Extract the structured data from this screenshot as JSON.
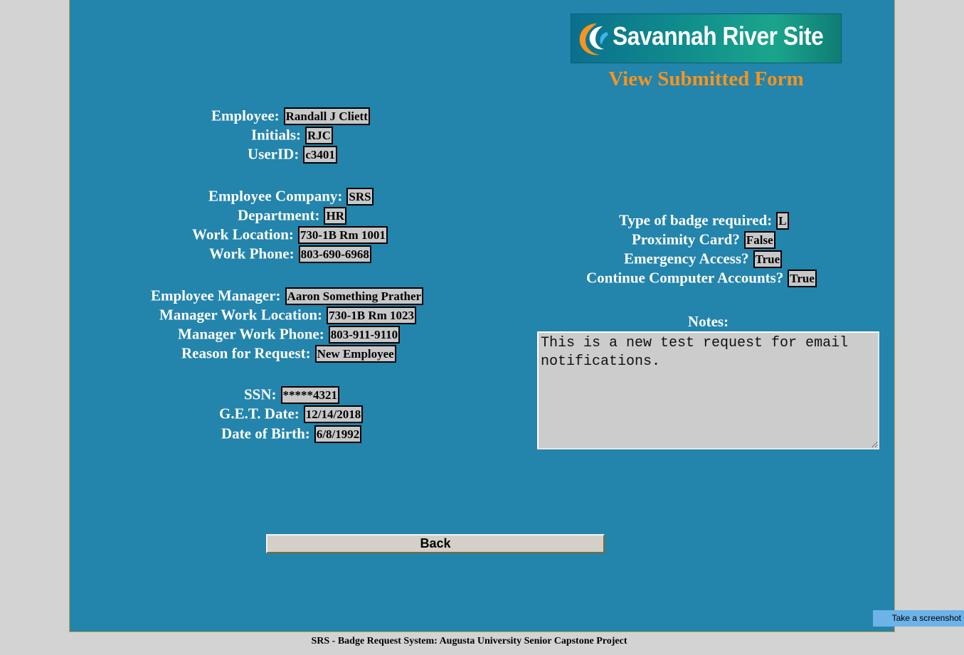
{
  "header": {
    "logo_text": "Savannah River Site",
    "page_title": "View Submitted Form"
  },
  "employee": {
    "employee_label": "Employee:",
    "employee_value": "Randall J Cliett",
    "initials_label": "Initials:",
    "initials_value": "RJC",
    "userid_label": "UserID:",
    "userid_value": "c3401"
  },
  "company": {
    "company_label": "Employee Company:",
    "company_value": "SRS",
    "department_label": "Department:",
    "department_value": "HR",
    "location_label": "Work Location:",
    "location_value": "730-1B Rm 1001",
    "phone_label": "Work Phone:",
    "phone_value": "803-690-6968"
  },
  "manager": {
    "manager_label": "Employee Manager:",
    "manager_value": "Aaron Something Prather",
    "location_label": "Manager Work Location:",
    "location_value": "730-1B Rm 1023",
    "phone_label": "Manager Work Phone:",
    "phone_value": "803-911-9110",
    "reason_label": "Reason for Request:",
    "reason_value": "New Employee"
  },
  "personal": {
    "ssn_label": "SSN:",
    "ssn_value": "*****4321",
    "get_label": "G.E.T. Date:",
    "get_value": "12/14/2018",
    "dob_label": "Date of Birth:",
    "dob_value": "6/8/1992"
  },
  "badge": {
    "type_label": "Type of badge required:",
    "type_value": "L",
    "proximity_label": "Proximity Card?",
    "proximity_value": "False",
    "emergency_label": "Emergency Access?",
    "emergency_value": "True",
    "accounts_label": "Continue Computer Accounts?",
    "accounts_value": "True"
  },
  "notes": {
    "label": "Notes:",
    "value": "This is a new test request for email notifications."
  },
  "actions": {
    "back_label": "Back"
  },
  "footer": {
    "text": "SRS - Badge Request System: Augusta University Senior Capstone Project"
  },
  "overlay": {
    "screenshot_label": "Take a screenshot"
  },
  "colors": {
    "panel_background": "#2384ac",
    "page_background": "#d3d3d3",
    "title_orange": "#f7941d",
    "field_background": "#c8c8c8"
  }
}
